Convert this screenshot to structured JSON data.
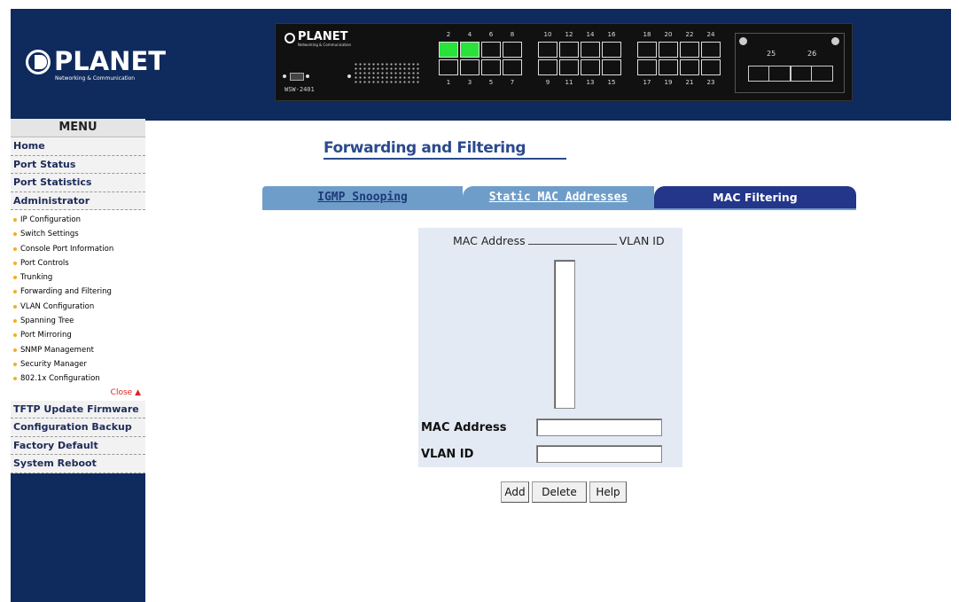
{
  "brand": {
    "name": "PLANET",
    "tagline": "Networking & Communication"
  },
  "switch_panel": {
    "brand": "PLANET",
    "brand_sub": "Networking & Communication",
    "model": "WSW-2401",
    "top_port_numbers": [
      "2",
      "4",
      "6",
      "8",
      "10",
      "12",
      "14",
      "16",
      "18",
      "20",
      "22",
      "24"
    ],
    "bottom_port_numbers": [
      "1",
      "3",
      "5",
      "7",
      "9",
      "11",
      "13",
      "15",
      "17",
      "19",
      "21",
      "23"
    ],
    "active_ports": [
      "2",
      "4"
    ],
    "sfp_port_numbers": [
      "25",
      "26"
    ],
    "colors": {
      "active_port": "#29e33b",
      "chassis": "#111111"
    }
  },
  "menu": {
    "title": "MENU",
    "top_items": [
      "Home",
      "Port Status",
      "Port Statistics",
      "Administrator"
    ],
    "sub_items": [
      "IP Configuration",
      "Switch Settings",
      "Console Port Information",
      "Port Controls",
      "Trunking",
      "Forwarding and Filtering",
      "VLAN Configuration",
      "Spanning Tree",
      "Port Mirroring",
      "SNMP Management",
      "Security Manager",
      "802.1x Configuration"
    ],
    "close_label": "Close",
    "bottom_items": [
      "TFTP Update Firmware",
      "Configuration Backup",
      "Factory Default",
      "System Reboot"
    ]
  },
  "page": {
    "title": "Forwarding and Filtering",
    "tabs": [
      {
        "label": "IGMP Snooping",
        "active": false
      },
      {
        "label": "Static MAC Addresses",
        "active": false
      },
      {
        "label": "MAC Filtering",
        "active": true
      }
    ]
  },
  "form": {
    "list_header_mac": "MAC Address",
    "list_header_vlan": "VLAN ID",
    "mac_label": "MAC Address",
    "mac_value": "",
    "vlan_label": "VLAN ID",
    "vlan_value": ""
  },
  "buttons": {
    "add": "Add",
    "delete": "Delete",
    "help": "Help"
  },
  "colors": {
    "navy": "#0f2a5c",
    "tab_inactive": "#6f9dc9",
    "tab_active": "#23368a",
    "title": "#2b4a8e",
    "panel_bg": "#e3eaf3"
  }
}
